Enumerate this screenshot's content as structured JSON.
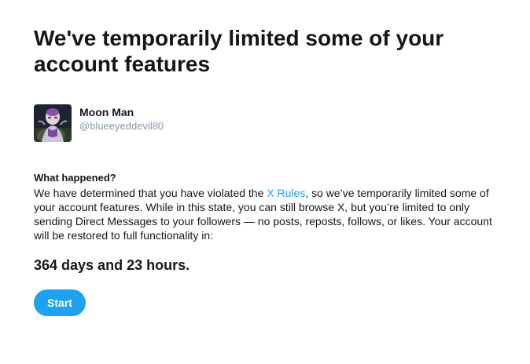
{
  "headline": "We've temporarily limited some of your account features",
  "account": {
    "display_name": "Moon Man",
    "handle": "@blueeyeddevil80",
    "avatar_icon": "character-avatar"
  },
  "what_happened": {
    "title": "What happened?",
    "text_before_link": "We have determined that you have violated the ",
    "link_label": "X Rules",
    "text_after_link": ", so we’ve temporarily limited some of your account features. While in this state, you can still browse X, but you’re limited to only sending Direct Messages to your followers — no posts, reposts, follows, or likes. Your account will be restored to full functionality in:"
  },
  "countdown": "364 days and 23 hours.",
  "start_button": {
    "label": "Start"
  },
  "colors": {
    "accent": "#1da1f2",
    "text": "#14171a",
    "muted": "#8899a6"
  }
}
